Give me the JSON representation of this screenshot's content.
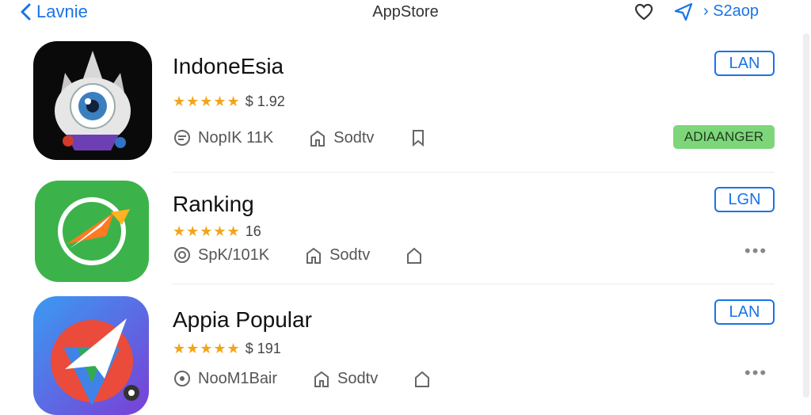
{
  "header": {
    "back_label": "Lavnie",
    "title": "AppStore",
    "right_link": "S2aop"
  },
  "apps": [
    {
      "name": "IndoneEsia",
      "rating_text": "$ 1.92",
      "stat1": "NopIK 11K",
      "stat2": "Sodtv",
      "action_label": "LAN",
      "badge": "ADIAANGER"
    },
    {
      "name": "Ranking",
      "rating_text": "16",
      "stat1": "SpK/101K",
      "stat2": "Sodtv",
      "action_label": "LGN",
      "more_label": "•••"
    },
    {
      "name": "Appia Popular",
      "rating_text": "$ 191",
      "stat1": "NooM1Bair",
      "stat2": "Sodtv",
      "action_label": "LAN",
      "more_label": "•••"
    }
  ],
  "colors": {
    "accent": "#1a73e8",
    "star": "#f2a51a",
    "badge_bg": "#7ed67a"
  }
}
